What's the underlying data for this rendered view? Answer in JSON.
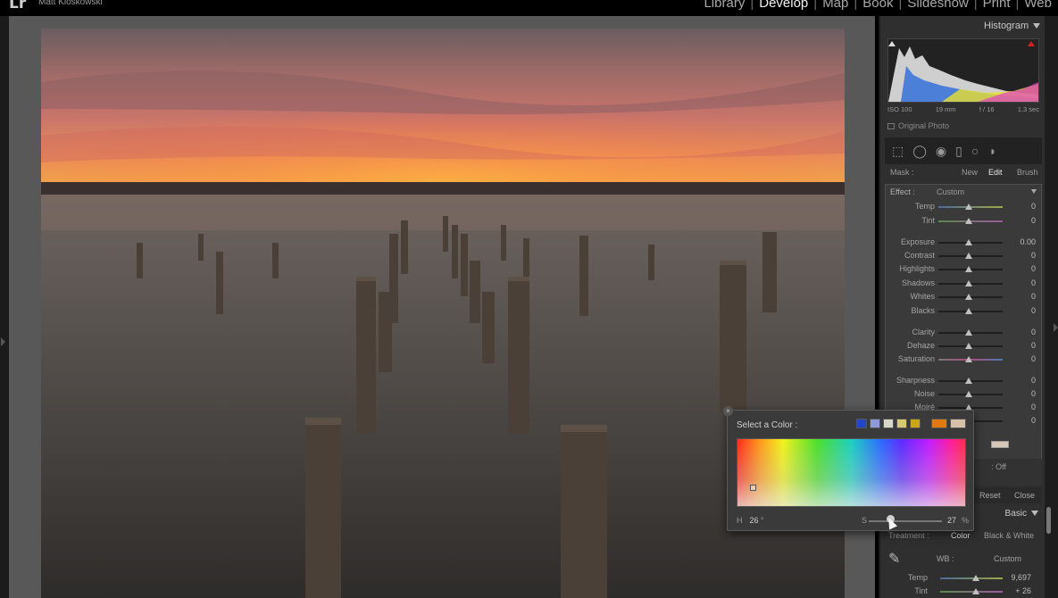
{
  "app": {
    "logo": "Lr",
    "identity": "Matt Kloskowski"
  },
  "modules": [
    {
      "label": "Library",
      "active": false
    },
    {
      "label": "Develop",
      "active": true
    },
    {
      "label": "Map",
      "active": false
    },
    {
      "label": "Book",
      "active": false
    },
    {
      "label": "Slideshow",
      "active": false
    },
    {
      "label": "Print",
      "active": false
    },
    {
      "label": "Web",
      "active": false
    }
  ],
  "histogram": {
    "title": "Histogram",
    "iso": "ISO 100",
    "focal": "19 mm",
    "aperture": "f / 16",
    "shutter": "1.3 sec",
    "original_photo_label": "Original Photo"
  },
  "mask": {
    "label": "Mask :",
    "new": "New",
    "edit": "Edit",
    "brush": "Brush"
  },
  "effect": {
    "label": "Effect :",
    "preset": "Custom",
    "sliders": [
      {
        "label": "Temp",
        "value": "0"
      },
      {
        "label": "Tint",
        "value": "0"
      },
      {
        "label": "Exposure",
        "value": "0.00"
      },
      {
        "label": "Contrast",
        "value": "0"
      },
      {
        "label": "Highlights",
        "value": "0"
      },
      {
        "label": "Shadows",
        "value": "0"
      },
      {
        "label": "Whites",
        "value": "0"
      },
      {
        "label": "Blacks",
        "value": "0"
      },
      {
        "label": "Clarity",
        "value": "0"
      },
      {
        "label": "Dehaze",
        "value": "0"
      },
      {
        "label": "Saturation",
        "value": "0"
      },
      {
        "label": "Sharpness",
        "value": "0"
      },
      {
        "label": "Noise",
        "value": "0"
      },
      {
        "label": "Moiré",
        "value": "0"
      },
      {
        "label": "",
        "value": "0"
      }
    ]
  },
  "auto_mask": {
    "label": ": Off"
  },
  "reset_row": {
    "reset": "Reset",
    "close": "Close"
  },
  "basic": {
    "title": "Basic",
    "treatment_label": "Treatment :",
    "color": "Color",
    "bw": "Black & White",
    "wb_label": "WB :",
    "wb_value": "Custom",
    "sliders": [
      {
        "label": "Temp",
        "value": "9,697"
      },
      {
        "label": "Tint",
        "value": "+ 26"
      }
    ]
  },
  "picker": {
    "title": "Select a Color :",
    "close": "×",
    "swatches": [
      "#2346c8",
      "#8a9ad8",
      "#d8d8c8",
      "#d8c870",
      "#c8a818"
    ],
    "recent_swatches": [
      "#e07a10",
      "#d8c0a8"
    ],
    "h_label": "H",
    "h_value": "26",
    "h_unit": "°",
    "s_label": "S",
    "s_value": "27",
    "s_unit": "%"
  },
  "colors": {
    "panel_bg": "#2f2f2f",
    "canvas_bg": "#585858",
    "active_text": "#f0f0f0"
  }
}
